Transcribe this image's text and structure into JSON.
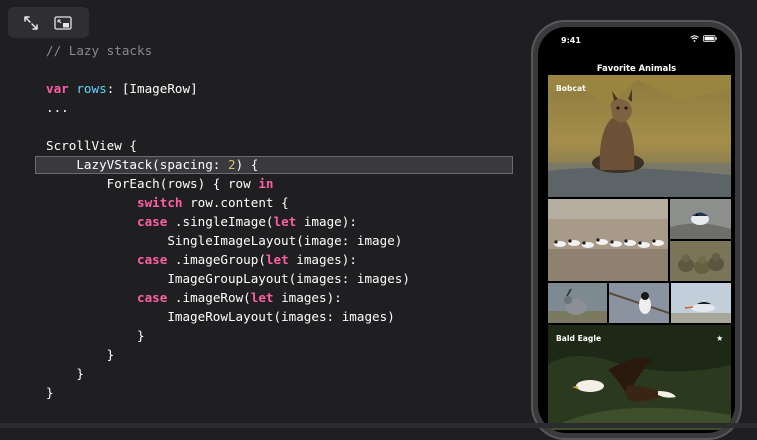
{
  "code": {
    "lines": [
      "// Lazy stacks",
      "",
      "var rows: [ImageRow]",
      "...",
      "",
      "ScrollView {",
      "    LazyVStack(spacing: 2) {",
      "        ForEach(rows) { row in",
      "            switch row.content {",
      "            case .singleImage(let image):",
      "                SingleImageLayout(image: image)",
      "            case .imageGroup(let images):",
      "                ImageGroupLayout(images: images)",
      "            case .imageRow(let images):",
      "                ImageRowLayout(images: images)",
      "            }",
      "        }",
      "    }",
      "}"
    ],
    "highlighted_line": 6
  },
  "controls": {
    "buttons": [
      {
        "icon": "expand-arrows-icon"
      },
      {
        "icon": "picture-in-picture-icon"
      }
    ]
  },
  "phone": {
    "status_time": "9:41",
    "nav_title": "Favorite Animals",
    "tiles": [
      {
        "label": "Bobcat",
        "icon": "bobcat-photo",
        "favorite": false
      },
      {
        "label": "",
        "icon": "shorebirds-photo"
      },
      {
        "label": "",
        "icon": "small-bird-photo"
      },
      {
        "label": "",
        "icon": "ducklings-photo"
      },
      {
        "label": "",
        "icon": "quail-photo"
      },
      {
        "label": "",
        "icon": "chickadee-photo"
      },
      {
        "label": "",
        "icon": "tern-photo"
      },
      {
        "label": "Bald Eagle",
        "icon": "bald-eagle-photo",
        "favorite": true
      }
    ],
    "star_glyph": "★"
  },
  "colors": {
    "background": "#1f1f21",
    "keyword": "#fc5fa3",
    "type": "#5dd8ff",
    "number": "#d0bf69",
    "comment": "#8a8a8f"
  }
}
